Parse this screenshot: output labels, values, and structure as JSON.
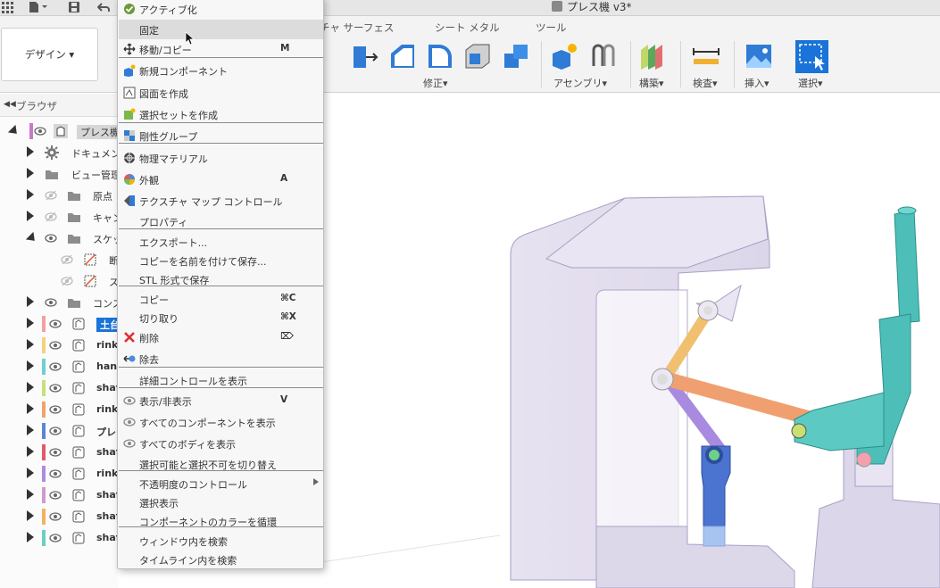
{
  "document": {
    "title": "プレス機 v3*"
  },
  "ribbon": {
    "design_label": "デザイン",
    "tabs": [
      "チャ サーフェス",
      "シート メタル",
      "ツール"
    ],
    "groups": {
      "modify": "修正",
      "assemble": "アセンブリ",
      "construct": "構築",
      "inspect": "検査",
      "insert": "挿入",
      "select": "選択"
    }
  },
  "browser": {
    "title": "ブラウザ",
    "items": [
      {
        "label": "プレス機",
        "bold": false,
        "icon": "component-icon",
        "color": "#c87ac8"
      },
      {
        "label": "ドキュメン",
        "icon": "gear-icon"
      },
      {
        "label": "ビュー管理",
        "icon": "folder-icon"
      },
      {
        "label": "原点",
        "icon": "folder-icon"
      },
      {
        "label": "キャン",
        "icon": "folder-icon"
      },
      {
        "label": "スケッ",
        "icon": "folder-icon"
      },
      {
        "label": "断",
        "icon": "sketch-icon"
      },
      {
        "label": "ス",
        "icon": "sketch-icon"
      },
      {
        "label": "コンス",
        "icon": "folder-icon"
      },
      {
        "label": "土台",
        "icon": "component-icon",
        "color": "#f4a0a0"
      },
      {
        "label": "rink",
        "icon": "component-icon",
        "color": "#f5d27a"
      },
      {
        "label": "han",
        "icon": "component-icon",
        "color": "#6fd0d0"
      },
      {
        "label": "shaf",
        "icon": "component-icon",
        "color": "#c8e07a"
      },
      {
        "label": "rink",
        "icon": "component-icon",
        "color": "#f0a46a"
      },
      {
        "label": "プレ",
        "icon": "component-icon",
        "color": "#5a86d6"
      },
      {
        "label": "shaf",
        "icon": "component-icon",
        "color": "#e05a6a"
      },
      {
        "label": "rink",
        "icon": "component-icon",
        "color": "#b08ae0"
      },
      {
        "label": "shaf",
        "icon": "component-icon",
        "color": "#d09ad0"
      },
      {
        "label": "shaf",
        "icon": "component-icon",
        "color": "#f5b060"
      },
      {
        "label": "shaf",
        "icon": "component-icon",
        "color": "#6ad0c0"
      }
    ]
  },
  "context_menu": {
    "items": [
      {
        "label": "アクティブ化",
        "icon": "check-icon"
      },
      {
        "label": "固定",
        "highlighted": true
      },
      {
        "label": "移動/コピー",
        "icon": "move-icon",
        "shortcut": "M"
      },
      {
        "label": "新規コンポーネント",
        "icon": "new-component-icon"
      },
      {
        "label": "図面を作成",
        "icon": "drawing-icon"
      },
      {
        "label": "選択セットを作成",
        "icon": "selection-set-icon"
      },
      {
        "label": "剛性グループ",
        "icon": "rigid-group-icon"
      },
      {
        "label": "物理マテリアル",
        "icon": "material-icon"
      },
      {
        "label": "外観",
        "icon": "appearance-icon",
        "shortcut": "A"
      },
      {
        "label": "テクスチャ マップ コントロール",
        "icon": "texture-map-icon"
      },
      {
        "label": "プロパティ"
      },
      {
        "label": "エクスポート..."
      },
      {
        "label": "コピーを名前を付けて保存..."
      },
      {
        "label": "STL 形式で保存"
      },
      {
        "label": "コピー",
        "shortcut": "⌘C"
      },
      {
        "label": "切り取り",
        "shortcut": "⌘X"
      },
      {
        "label": "削除",
        "icon": "delete-icon",
        "shortcut": "⌦"
      },
      {
        "label": "除去",
        "icon": "remove-icon"
      },
      {
        "label": "詳細コントロールを表示"
      },
      {
        "label": "表示/非表示",
        "icon": "eye-icon",
        "shortcut": "V"
      },
      {
        "label": "すべてのコンポーネントを表示",
        "icon": "eye-icon"
      },
      {
        "label": "すべてのボディを表示",
        "icon": "eye-icon"
      },
      {
        "label": "選択可能と選択不可を切り替え"
      },
      {
        "label": "不透明度のコントロール",
        "submenu": true
      },
      {
        "label": "選択表示"
      },
      {
        "label": "コンポーネントのカラーを循環"
      },
      {
        "label": "ウィンドウ内を検索"
      },
      {
        "label": "タイムライン内を検索"
      }
    ]
  }
}
